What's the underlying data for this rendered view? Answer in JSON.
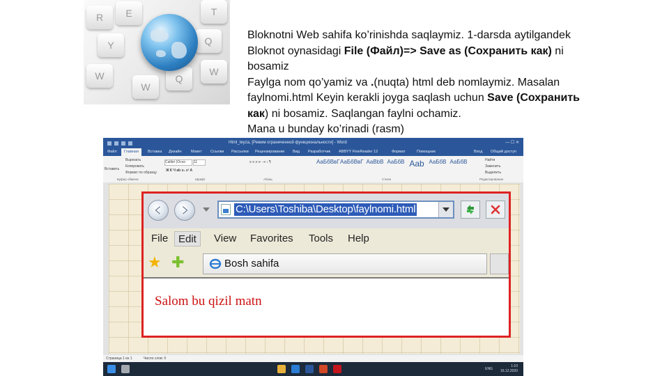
{
  "paragraph": {
    "line1": "Bloknotni Web sahifa ko’rinishda saqlaymiz. 1-darsda aytilgandek",
    "line2_start": "Bloknot oynasidagi ",
    "line2_bold": "File (Файл)=> Save as (Сохранить как)",
    "line2_end": " ni",
    "line3": "bosamiz",
    "line4": "Faylga nom qo’yamiz va ",
    "line4_bold": ".",
    "line4_end": "(nuqta) html deb nomlaymiz. Masalan",
    "line5_start": "faylnomi.html Keyin kerakli joyga saqlash uchun ",
    "line5_bold": "Save (Сохранить",
    "line6_bold": "как",
    "line6_end": ")  ni bosamiz. Saqlangan faylni ochamiz.",
    "line7": "Mana u bunday ko’rinadi (rasm)"
  },
  "hero_keys": [
    "R",
    "E",
    "T",
    "Y",
    "Q",
    "W",
    "W",
    "Q",
    "W"
  ],
  "word": {
    "title": "Html_teyza, [Режим ограниченной функциональности] - Word",
    "tabs": [
      "Файл",
      "Главная",
      "Вставка",
      "Дизайн",
      "Макет",
      "Ссылки",
      "Рассылки",
      "Рецензирование",
      "Вид",
      "Разработчик",
      "ABBYY FineReader 12",
      "Формат",
      "Помощник"
    ],
    "account": [
      "Вход",
      "Общий доступ"
    ],
    "clipboard": [
      "Вырезать",
      "Копировать",
      "Формат по образцу"
    ],
    "paste": "Вставить",
    "font_name": "Calibri (Осно",
    "font_size": "11",
    "styles": [
      "АаБбВвГ",
      "АаБбВвГ",
      "AaBbB",
      "АаБбВ",
      "Aab",
      "АаБбВ",
      "АаБбВ"
    ],
    "editing": [
      "Найти",
      "Заменить",
      "Выделить"
    ],
    "groups": [
      "Буфер обмена",
      "Шрифт",
      "Абзац",
      "Стили",
      "Редактирование"
    ],
    "status": [
      "Страница 1 из 1",
      "Число слов: 0"
    ],
    "clock": [
      "1:10",
      "16.12.2020"
    ],
    "lang": "ENG"
  },
  "browser": {
    "url": "C:\\Users\\Toshiba\\Desktop\\faylnomi.html",
    "menu": [
      "File",
      "Edit",
      "View",
      "Favorites",
      "Tools",
      "Help"
    ],
    "selected_menu": "Edit",
    "fav_tab": "Bosh sahifa",
    "content_text": "Salom bu qizil matn",
    "content_color": "#cc1111",
    "frame_color": "#dd2222"
  }
}
